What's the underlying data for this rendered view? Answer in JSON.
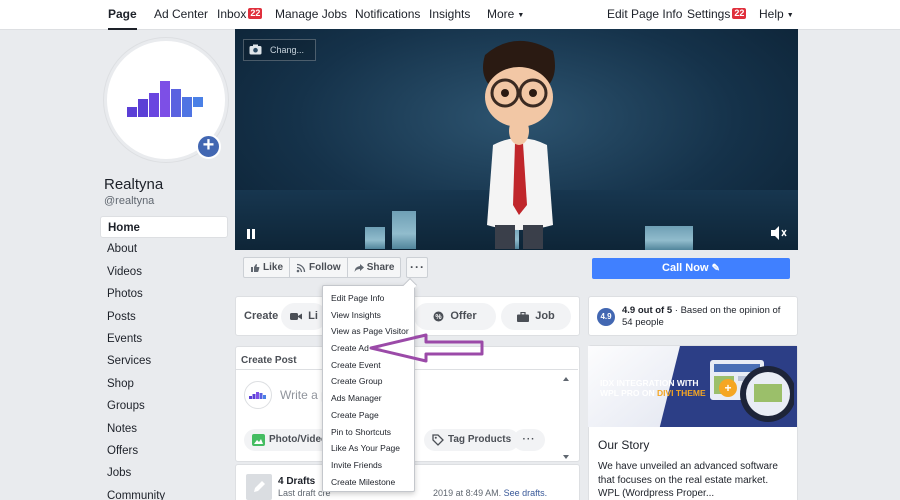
{
  "topnav": {
    "page": "Page",
    "ad_center": "Ad Center",
    "inbox": "Inbox",
    "inbox_count": "22",
    "manage_jobs": "Manage Jobs",
    "notifications": "Notifications",
    "insights": "Insights",
    "more": "More",
    "edit_page_info": "Edit Page Info",
    "settings": "Settings",
    "settings_count": "22",
    "help": "Help"
  },
  "profile": {
    "name": "Realtyna",
    "handle": "@realtyna",
    "logo_color": "#5b3fd6"
  },
  "sidenav": {
    "items": [
      "Home",
      "About",
      "Videos",
      "Photos",
      "Posts",
      "Events",
      "Services",
      "Shop",
      "Groups",
      "Notes",
      "Offers",
      "Jobs",
      "Community"
    ]
  },
  "cover": {
    "change_label": "Chang..."
  },
  "actions": {
    "like": "Like",
    "follow": "Follow",
    "share": "Share",
    "more": "···",
    "call_now": "Call Now"
  },
  "create": {
    "label": "Create",
    "live": "Li",
    "offer": "Offer",
    "job": "Job"
  },
  "create_post": {
    "header": "Create Post",
    "placeholder": "Write a po",
    "photo_video": "Photo/Video",
    "tag_products": "Tag Products",
    "more": "···"
  },
  "drafts": {
    "title": "4 Drafts",
    "subtitle": "Last draft cre",
    "subtitle_tail": "2019 at 8:49 AM.",
    "link": "See drafts."
  },
  "rating": {
    "score": "4.9",
    "text_bold": "4.9 out of 5",
    "text": " · Based on the opinion of 54 people"
  },
  "banner": {
    "line1": "IDX INTEGRATION WITH",
    "line2": "WPL PRO ON ",
    "line2_highlight": "DIVI THEME"
  },
  "story": {
    "title": "Our Story",
    "text": "We have unveiled an advanced software that focuses on the real estate market. WPL (Wordpress Proper..."
  },
  "menu": {
    "items": [
      "Edit Page Info",
      "View Insights",
      "View as Page Visitor",
      "Create Ad",
      "Create Event",
      "Create Group",
      "Ads Manager",
      "Create Page",
      "Pin to Shortcuts",
      "Like As Your Page",
      "Invite Friends",
      "Create Milestone"
    ]
  },
  "colors": {
    "accent": "#4267b2",
    "call_now": "#4080ff",
    "badge": "#e02f3c",
    "annotation_arrow": "#9b4aa8"
  }
}
